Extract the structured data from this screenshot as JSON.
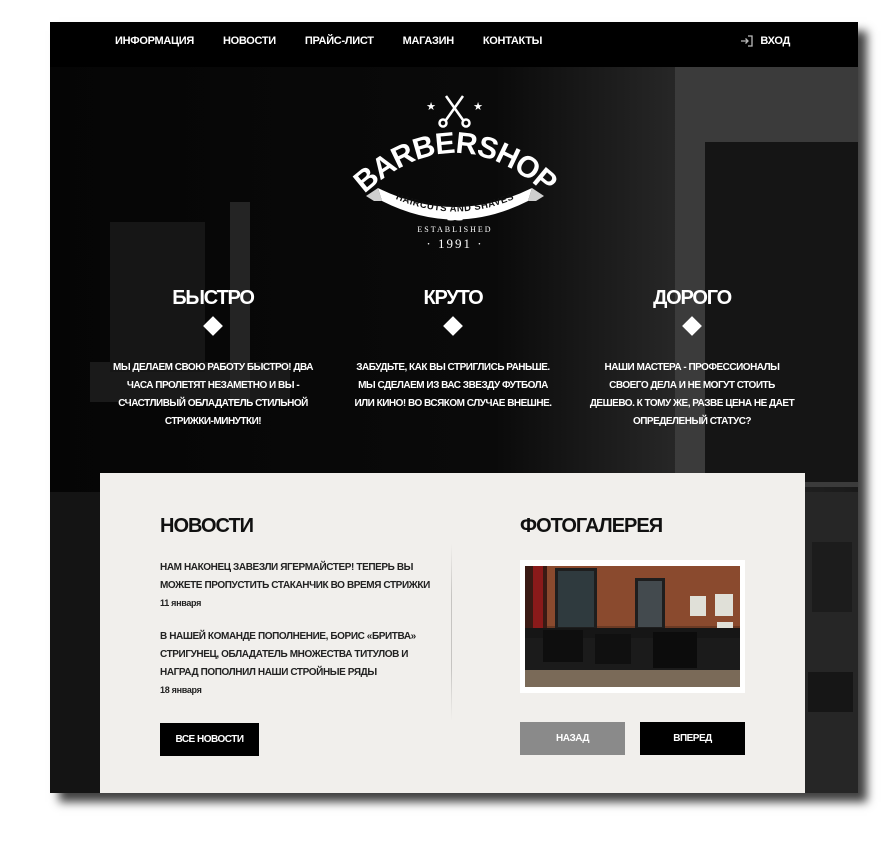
{
  "nav": {
    "items": [
      {
        "label": "ИНФОРМАЦИЯ"
      },
      {
        "label": "НОВОСТИ"
      },
      {
        "label": "ПРАЙС-ЛИСТ"
      },
      {
        "label": "МАГАЗИН"
      },
      {
        "label": "КОНТАКТЫ"
      }
    ],
    "login": {
      "label": "ВХОД",
      "icon": "login-icon"
    }
  },
  "logo": {
    "name": "BARBERSHOP",
    "tagline": "HAIRCUTS AND SHAVES",
    "established": "ESTABLISHED",
    "year": "· 1991 ·"
  },
  "features": [
    {
      "title": "БЫСТРО",
      "text": "МЫ ДЕЛАЕМ СВОЮ РАБОТУ БЫСТРО! ДВА ЧАСА ПРОЛЕТЯТ НЕЗАМЕТНО И ВЫ - СЧАСТЛИВЫЙ ОБЛАДАТЕЛЬ СТИЛЬНОЙ СТРИЖКИ-МИНУТКИ!"
    },
    {
      "title": "КРУТО",
      "text": "ЗАБУДЬТЕ, КАК ВЫ СТРИГЛИСЬ РАНЬШЕ. МЫ СДЕЛАЕМ ИЗ ВАС ЗВЕЗДУ ФУТБОЛА ИЛИ КИНО! ВО ВСЯКОМ СЛУЧАЕ ВНЕШНЕ."
    },
    {
      "title": "ДОРОГО",
      "text": "НАШИ МАСТЕРА - ПРОФЕССИОНАЛЫ СВОЕГО ДЕЛА И НЕ МОГУТ СТОИТЬ ДЕШЕВО. К ТОМУ ЖЕ, РАЗВЕ ЦЕНА НЕ ДАЕТ ОПРЕДЕЛЕНЫЙ СТАТУС?"
    }
  ],
  "news": {
    "title": "НОВОСТИ",
    "items": [
      {
        "text": "НАМ НАКОНЕЦ ЗАВЕЗЛИ ЯГЕРМАЙСТЕР! ТЕПЕРЬ ВЫ МОЖЕТЕ ПРОПУСТИТЬ СТАКАНЧИК ВО ВРЕМЯ СТРИЖКИ",
        "date": "11 января"
      },
      {
        "text": "В НАШЕЙ КОМАНДЕ ПОПОЛНЕНИЕ, БОРИС «БРИТВА» СТРИГУНЕЦ, ОБЛАДАТЕЛЬ МНОЖЕСТВА ТИТУЛОВ И НАГРАД ПОПОЛНИЛ НАШИ СТРОЙНЫЕ РЯДЫ",
        "date": "18 января"
      }
    ],
    "all_button": "ВСЕ НОВОСТИ"
  },
  "gallery": {
    "title": "ФОТОГАЛЕРЕЯ",
    "prev_button": "НАЗАД",
    "next_button": "ВПЕРЕД"
  },
  "colors": {
    "page_bg": "#0b0b0b",
    "panel_bg": "#f1efec",
    "button_dark": "#000000",
    "button_disabled": "#8a8a8a"
  }
}
